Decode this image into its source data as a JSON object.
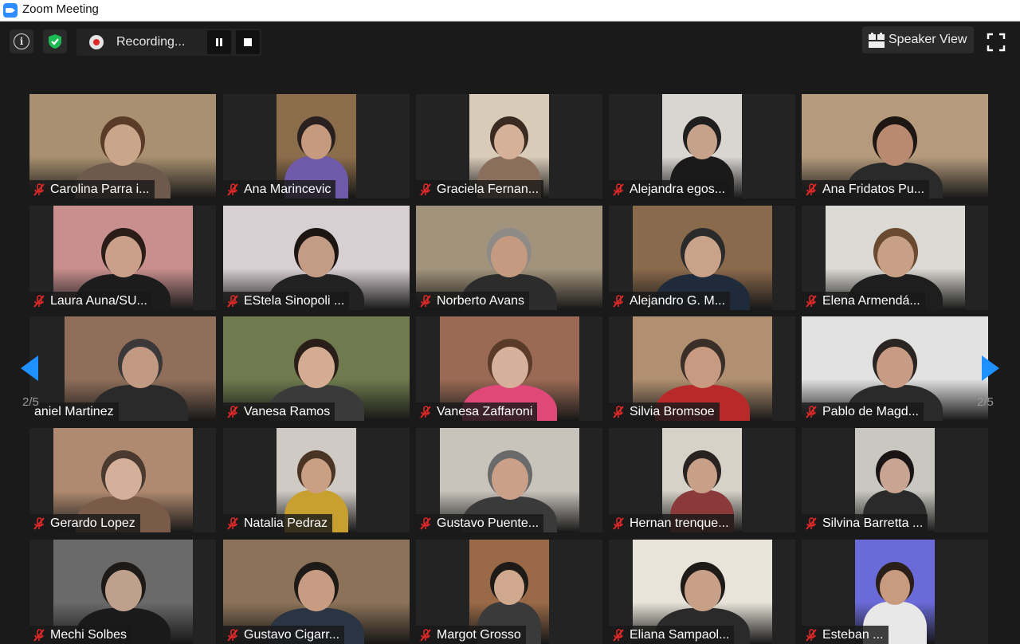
{
  "window": {
    "title": "Zoom Meeting"
  },
  "toolbar": {
    "recording_label": "Recording...",
    "view_label": "Speaker View"
  },
  "pagination": {
    "left_label": "2/5",
    "right_label": "2/5"
  },
  "colors": {
    "mute_red": "#e02828",
    "accent_blue": "#2d8cff",
    "shield_green": "#1db954"
  },
  "participants": [
    {
      "name": "Carolina Parra i...",
      "muted": true,
      "scene": {
        "bg": "#a89070",
        "skin": "#c9a58a",
        "shirt": "#6d5a4c",
        "hair": "#5a3b28"
      }
    },
    {
      "name": "Ana Marincevic",
      "muted": true,
      "scene": {
        "bg": "#8c6d4b",
        "skin": "#c69a7e",
        "shirt": "#6e5aa8",
        "hair": "#2a2020"
      }
    },
    {
      "name": "Graciela Fernan...",
      "muted": true,
      "scene": {
        "bg": "#d8cbb8",
        "skin": "#d6b19a",
        "shirt": "#8a6f5c",
        "hair": "#3a2a22"
      }
    },
    {
      "name": "Alejandra egos...",
      "muted": true,
      "scene": {
        "bg": "#d9d6d2",
        "skin": "#c7a28a",
        "shirt": "#1a1a1a",
        "hair": "#1f1f1f"
      }
    },
    {
      "name": "Ana Fridatos Pu...",
      "muted": true,
      "scene": {
        "bg": "#b59a7c",
        "skin": "#b98a70",
        "shirt": "#2a2a2a",
        "hair": "#1d1612"
      }
    },
    {
      "name": "Laura Auna/SU...",
      "muted": true,
      "scene": {
        "bg": "#c98f8f",
        "skin": "#caa08a",
        "shirt": "#1c1c1c",
        "hair": "#2a1d18"
      }
    },
    {
      "name": "EStela Sinopoli ...",
      "muted": true,
      "scene": {
        "bg": "#d8cfd2",
        "skin": "#c39c86",
        "shirt": "#222222",
        "hair": "#1d1512"
      }
    },
    {
      "name": "Norberto Avans",
      "muted": true,
      "scene": {
        "bg": "#a2947c",
        "skin": "#c49a80",
        "shirt": "#2c2c2c",
        "hair": "#8e8a86"
      }
    },
    {
      "name": "Alejandro G. M...",
      "muted": true,
      "scene": {
        "bg": "#8a6a4c",
        "skin": "#c9a28a",
        "shirt": "#1f2a3a",
        "hair": "#2a2a2a"
      }
    },
    {
      "name": "Elena Armendá...",
      "muted": true,
      "scene": {
        "bg": "#dcdad4",
        "skin": "#c7a086",
        "shirt": "#1e1e1e",
        "hair": "#6a4a30"
      }
    },
    {
      "name": "aniel Martinez",
      "muted": false,
      "scene": {
        "bg": "#8f6f5a",
        "skin": "#c29a84",
        "shirt": "#2a2a2a",
        "hair": "#3a3838"
      }
    },
    {
      "name": "Vanesa Ramos",
      "muted": true,
      "scene": {
        "bg": "#6f7a4e",
        "skin": "#d3ac92",
        "shirt": "#3a3a3a",
        "hair": "#2a1e18"
      }
    },
    {
      "name": "Vanesa Zaffaroni",
      "muted": true,
      "scene": {
        "bg": "#9a6a55",
        "skin": "#d5b09a",
        "shirt": "#e0487a",
        "hair": "#5a3a28"
      }
    },
    {
      "name": "Silvia Bromsoe",
      "muted": true,
      "scene": {
        "bg": "#b09070",
        "skin": "#c89a82",
        "shirt": "#b82a2a",
        "hair": "#3a2e28"
      }
    },
    {
      "name": "Pablo de Magd...",
      "muted": true,
      "scene": {
        "bg": "#e2e2e2",
        "skin": "#c89c84",
        "shirt": "#2a2a2a",
        "hair": "#2a2522"
      }
    },
    {
      "name": "Gerardo Lopez",
      "muted": true,
      "scene": {
        "bg": "#b08a70",
        "skin": "#d4b09a",
        "shirt": "#7a5a48",
        "hair": "#4a3a30"
      }
    },
    {
      "name": "Natalia Pedraz",
      "muted": true,
      "scene": {
        "bg": "#cfcac4",
        "skin": "#c9a084",
        "shirt": "#c8a030",
        "hair": "#4a3424"
      }
    },
    {
      "name": "Gustavo Puente...",
      "muted": true,
      "scene": {
        "bg": "#c8c4bc",
        "skin": "#caa088",
        "shirt": "#3a3a3a",
        "hair": "#6a6a6a"
      }
    },
    {
      "name": "Hernan trenque...",
      "muted": true,
      "scene": {
        "bg": "#d6d2c8",
        "skin": "#c8a088",
        "shirt": "#8a3a3a",
        "hair": "#2a2220"
      }
    },
    {
      "name": "Silvina Barretta ...",
      "muted": true,
      "scene": {
        "bg": "#c8c8c0",
        "skin": "#c8a492",
        "shirt": "#2a2a2a",
        "hair": "#1a1414"
      }
    },
    {
      "name": "Mechi Solbes",
      "muted": true,
      "scene": {
        "bg": "#6a6a6a",
        "skin": "#bfa08c",
        "shirt": "#1a1a1a",
        "hair": "#1e1a18"
      }
    },
    {
      "name": "Gustavo Cigarr...",
      "muted": true,
      "scene": {
        "bg": "#8c7258",
        "skin": "#c79c82",
        "shirt": "#2a3442",
        "hair": "#1e1a18"
      }
    },
    {
      "name": "Margot Grosso",
      "muted": true,
      "scene": {
        "bg": "#9a6a48",
        "skin": "#cfa88e",
        "shirt": "#3a3a3a",
        "hair": "#1e1a18"
      }
    },
    {
      "name": "Eliana Sampaol...",
      "muted": true,
      "scene": {
        "bg": "#e8e4da",
        "skin": "#c8a088",
        "shirt": "#2a2a2a",
        "hair": "#1e1a18"
      }
    },
    {
      "name": "Esteban ...",
      "muted": true,
      "scene": {
        "bg": "#6a6ad8",
        "skin": "#c89a80",
        "shirt": "#e8e8e8",
        "hair": "#2a1e18"
      }
    }
  ]
}
